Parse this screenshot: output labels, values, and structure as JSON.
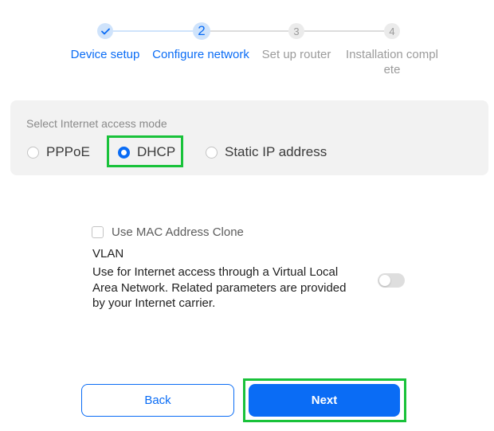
{
  "stepper": {
    "steps": [
      {
        "number": "",
        "label": "Device setup",
        "state": "completed",
        "icon": "check-icon"
      },
      {
        "number": "2",
        "label": "Configure network",
        "state": "current"
      },
      {
        "number": "3",
        "label": "Set up router",
        "state": "pending"
      },
      {
        "number": "4",
        "label": "Installation complete",
        "state": "pending"
      }
    ],
    "colors": {
      "active": "#0a6cf5",
      "active_bg": "#cfe3fb",
      "pending": "#ebebeb",
      "pending_text": "#9b9b9b"
    }
  },
  "mode": {
    "title": "Select Internet access mode",
    "options": [
      {
        "label": "PPPoE",
        "selected": false
      },
      {
        "label": "DHCP",
        "selected": true
      },
      {
        "label": "Static IP address",
        "selected": false
      }
    ]
  },
  "mac_clone": {
    "label": "Use MAC Address Clone",
    "checked": false
  },
  "vlan": {
    "title": "VLAN",
    "description": "Use for Internet access through a Virtual Local Area Network. Related parameters are provided by your Internet carrier.",
    "enabled": false
  },
  "buttons": {
    "back_label": "Back",
    "next_label": "Next"
  },
  "highlight_color": "#19c23a"
}
